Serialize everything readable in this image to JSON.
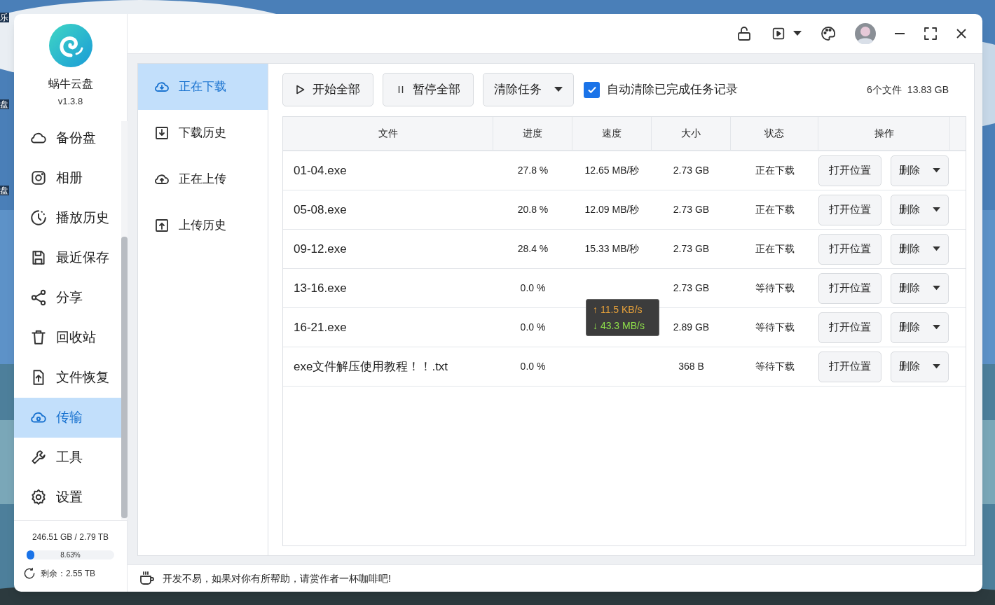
{
  "desktop": {
    "icon_labels": [
      "乐",
      "盘",
      "盘"
    ]
  },
  "app": {
    "name": "蜗牛云盘",
    "version": "v1.3.8"
  },
  "sidebar": {
    "items": [
      {
        "label": "备份盘",
        "selected": false
      },
      {
        "label": "相册",
        "selected": false
      },
      {
        "label": "播放历史",
        "selected": false
      },
      {
        "label": "最近保存",
        "selected": false
      },
      {
        "label": "分享",
        "selected": false
      },
      {
        "label": "回收站",
        "selected": false
      },
      {
        "label": "文件恢复",
        "selected": false
      },
      {
        "label": "传输",
        "selected": true
      },
      {
        "label": "工具",
        "selected": false
      },
      {
        "label": "设置",
        "selected": false
      }
    ],
    "storage": {
      "usage": "246.51 GB / 2.79 TB",
      "level": 0.0863,
      "percent": "8.63%",
      "remaining": "剩余：2.55 TB"
    }
  },
  "subnav": {
    "items": [
      {
        "label": "正在下载",
        "selected": true
      },
      {
        "label": "下载历史",
        "selected": false
      },
      {
        "label": "正在上传",
        "selected": false
      },
      {
        "label": "上传历史",
        "selected": false
      }
    ]
  },
  "toolbar": {
    "start_all": "开始全部",
    "pause_all": "暂停全部",
    "clear_tasks": "清除任务",
    "auto_clear": {
      "label": "自动清除已完成任务记录",
      "checked": true
    },
    "file_count": "6个文件",
    "total_size": "13.83 GB"
  },
  "table": {
    "columns": [
      "文件",
      "进度",
      "速度",
      "大小",
      "状态",
      "操作"
    ],
    "rows": [
      {
        "file": "01-04.exe",
        "progress": "27.8 %",
        "speed": "12.65 MB/秒",
        "size": "2.73 GB",
        "status": "正在下载",
        "open": "打开位置",
        "delete": "删除"
      },
      {
        "file": "05-08.exe",
        "progress": "20.8 %",
        "speed": "12.09 MB/秒",
        "size": "2.73 GB",
        "status": "正在下载",
        "open": "打开位置",
        "delete": "删除"
      },
      {
        "file": "09-12.exe",
        "progress": "28.4 %",
        "speed": "15.33 MB/秒",
        "size": "2.73 GB",
        "status": "正在下载",
        "open": "打开位置",
        "delete": "删除"
      },
      {
        "file": "13-16.exe",
        "progress": "0.0 %",
        "size": "2.73 GB",
        "status": "等待下载",
        "open": "打开位置",
        "delete": "删除"
      },
      {
        "file": "16-21.exe",
        "progress": "0.0 %",
        "size": "2.89 GB",
        "status": "等待下载",
        "open": "打开位置",
        "delete": "删除"
      },
      {
        "file": "exe文件解压使用教程！！.txt",
        "progress": "0.0 %",
        "size": "368 B",
        "status": "等待下载",
        "open": "打开位置",
        "delete": "删除"
      }
    ]
  },
  "speed_tooltip": {
    "upload": "↑ 11.5 KB/s",
    "download": "↓ 43.3 MB/s"
  },
  "footer": {
    "message": "开发不易，如果对你有所帮助，请赏作者一杯咖啡吧!"
  }
}
